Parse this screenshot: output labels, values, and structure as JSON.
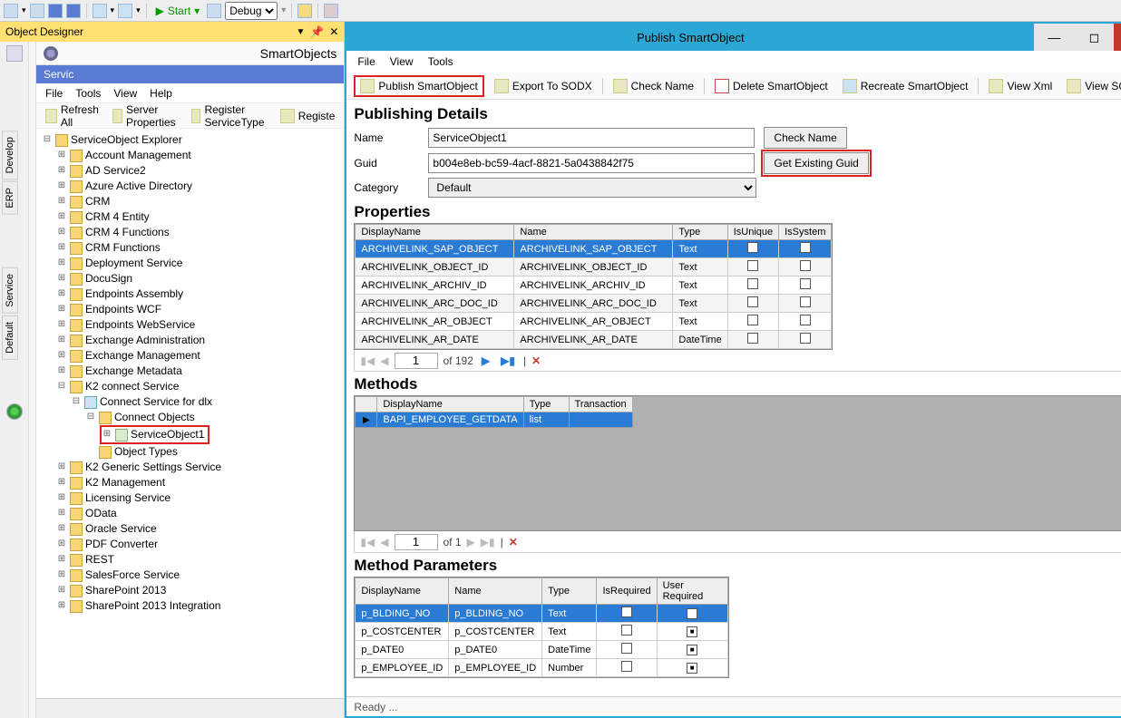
{
  "vs_toolbar": {
    "start_label": "Start",
    "config_label": "Debug"
  },
  "designer_panel": {
    "title": "Object Designer",
    "tab_label": "SmartObjects"
  },
  "left_vert_tabs": [
    "Develop",
    "ERP",
    "Service",
    "Default"
  ],
  "smart_menu": [
    "File",
    "Tools",
    "View",
    "Help"
  ],
  "smart_toolbar": {
    "refresh": "Refresh All",
    "server_props": "Server Properties",
    "register_st": "Register ServiceType",
    "register_more": "Registe"
  },
  "tree": {
    "root": "ServiceObject Explorer",
    "nodes": [
      "Account Management",
      "AD Service2",
      "Azure Active Directory",
      "CRM",
      "CRM 4 Entity",
      "CRM 4 Functions",
      "CRM Functions",
      "Deployment Service",
      "DocuSign",
      "Endpoints Assembly",
      "Endpoints WCF",
      "Endpoints WebService",
      "Exchange Administration",
      "Exchange Management",
      "Exchange Metadata"
    ],
    "k2connect": "K2 connect Service",
    "connect_service_for": "Connect Service for dlx",
    "connect_objects": "Connect Objects",
    "service_object1": "ServiceObject1",
    "object_types": "Object Types",
    "after": [
      "K2 Generic Settings Service",
      "K2 Management",
      "Licensing Service",
      "OData",
      "Oracle Service",
      "PDF Converter",
      "REST",
      "SalesForce Service",
      "SharePoint 2013",
      "SharePoint 2013 Integration"
    ]
  },
  "right_window": {
    "title": "Publish SmartObject",
    "menu": [
      "File",
      "View",
      "Tools"
    ],
    "toolbar": {
      "publish": "Publish SmartObject",
      "export": "Export To SODX",
      "check_name": "Check Name",
      "delete": "Delete SmartObject",
      "recreate": "Recreate SmartObject",
      "view_xml": "View Xml",
      "view_sodx": "View SODX"
    },
    "publishing_details_h": "Publishing Details",
    "labels": {
      "name": "Name",
      "guid": "Guid",
      "category": "Category"
    },
    "name_value": "ServiceObject1",
    "guid_value": "b004e8eb-bc59-4acf-8821-5a0438842f75",
    "category_value": "Default",
    "btn_check_name": "Check Name",
    "btn_get_guid": "Get Existing Guid",
    "properties_h": "Properties",
    "prop_cols": [
      "DisplayName",
      "Name",
      "Type",
      "IsUnique",
      "IsSystem"
    ],
    "prop_rows": [
      {
        "dn": "ARCHIVELINK_SAP_OBJECT",
        "n": "ARCHIVELINK_SAP_OBJECT",
        "t": "Text",
        "sel": true
      },
      {
        "dn": "ARCHIVELINK_OBJECT_ID",
        "n": "ARCHIVELINK_OBJECT_ID",
        "t": "Text",
        "alt": true
      },
      {
        "dn": "ARCHIVELINK_ARCHIV_ID",
        "n": "ARCHIVELINK_ARCHIV_ID",
        "t": "Text"
      },
      {
        "dn": "ARCHIVELINK_ARC_DOC_ID",
        "n": "ARCHIVELINK_ARC_DOC_ID",
        "t": "Text",
        "alt": true
      },
      {
        "dn": "ARCHIVELINK_AR_OBJECT",
        "n": "ARCHIVELINK_AR_OBJECT",
        "t": "Text"
      },
      {
        "dn": "ARCHIVELINK_AR_DATE",
        "n": "ARCHIVELINK_AR_DATE",
        "t": "DateTime",
        "alt": true
      }
    ],
    "prop_pager": {
      "page": "1",
      "total": "of 192"
    },
    "methods_h": "Methods",
    "method_cols": [
      "DisplayName",
      "Type",
      "Transaction"
    ],
    "method_rows": [
      {
        "dn": "BAPI_EMPLOYEE_GETDATA",
        "t": "list"
      }
    ],
    "method_pager": {
      "page": "1",
      "total": "of 1"
    },
    "params_h": "Method Parameters",
    "param_cols": [
      "DisplayName",
      "Name",
      "Type",
      "IsRequired",
      "User Required"
    ],
    "param_rows": [
      {
        "dn": "p_BLDING_NO",
        "n": "p_BLDING_NO",
        "t": "Text",
        "sel": true,
        "ur": true
      },
      {
        "dn": "p_COSTCENTER",
        "n": "p_COSTCENTER",
        "t": "Text",
        "ur": true
      },
      {
        "dn": "p_DATE0",
        "n": "p_DATE0",
        "t": "DateTime",
        "ur": true
      },
      {
        "dn": "p_EMPLOYEE_ID",
        "n": "p_EMPLOYEE_ID",
        "t": "Number",
        "ur": true
      }
    ],
    "status": "Ready ..."
  }
}
